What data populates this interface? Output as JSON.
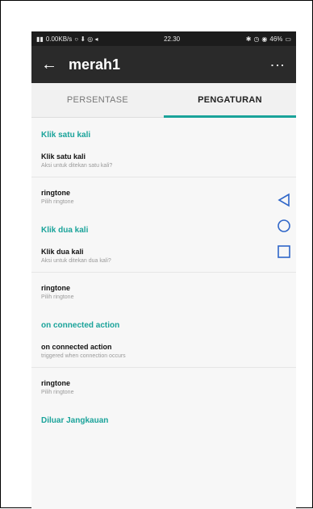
{
  "status": {
    "left": "0.00KB/s",
    "time": "22.30",
    "battery": "46%"
  },
  "appbar": {
    "title": "merah1"
  },
  "tabs": [
    {
      "label": "PERSENTASE"
    },
    {
      "label": "PENGATURAN"
    }
  ],
  "sections": [
    {
      "title": "Klik satu kali",
      "items": [
        {
          "title": "Klik satu kali",
          "subtitle": "Aksi untuk ditekan satu kali?"
        },
        {
          "title": "ringtone",
          "subtitle": "Pilih ringtone"
        }
      ]
    },
    {
      "title": "Klik dua kali",
      "items": [
        {
          "title": "Klik dua kali",
          "subtitle": "Aksi untuk ditekan dua kali?"
        },
        {
          "title": "ringtone",
          "subtitle": "Pilih ringtone"
        }
      ]
    },
    {
      "title": "on connected action",
      "items": [
        {
          "title": "on connected action",
          "subtitle": "triggered when connection occurs"
        },
        {
          "title": "ringtone",
          "subtitle": "Pilih ringtone"
        }
      ]
    },
    {
      "title": "Diluar Jangkauan",
      "items": []
    }
  ],
  "colors": {
    "accent": "#1aa39a",
    "appbar": "#2a2a2a"
  },
  "icons": {
    "back": "arrow-left-icon",
    "more": "more-vertical-icon",
    "nav_back": "triangle-back-icon",
    "nav_home": "circle-home-icon",
    "nav_recent": "square-recent-icon"
  }
}
